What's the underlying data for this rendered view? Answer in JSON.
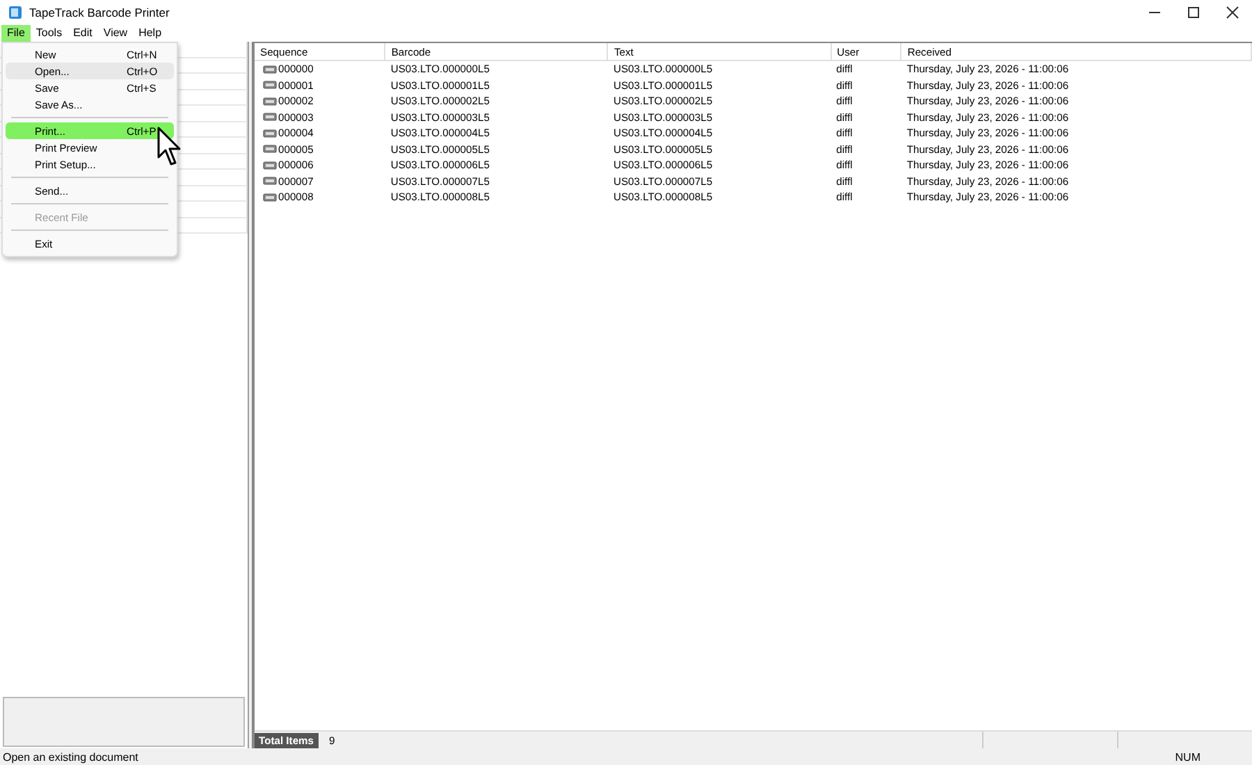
{
  "window": {
    "title": "TapeTrack Barcode Printer"
  },
  "menu_bar": [
    {
      "label": "File",
      "selected": true
    },
    {
      "label": "Tools",
      "selected": false
    },
    {
      "label": "Edit",
      "selected": false
    },
    {
      "label": "View",
      "selected": false
    },
    {
      "label": "Help",
      "selected": false
    }
  ],
  "file_menu": [
    {
      "kind": "item",
      "label": "New",
      "shortcut": "Ctrl+N",
      "selected": false,
      "hovered": false,
      "disabled": false
    },
    {
      "kind": "item",
      "label": "Open...",
      "shortcut": "Ctrl+O",
      "selected": false,
      "hovered": true,
      "disabled": false
    },
    {
      "kind": "item",
      "label": "Save",
      "shortcut": "Ctrl+S",
      "selected": false,
      "hovered": false,
      "disabled": false
    },
    {
      "kind": "item",
      "label": "Save As...",
      "selected": false,
      "hovered": false,
      "disabled": false
    },
    {
      "kind": "separator"
    },
    {
      "kind": "item",
      "label": "Print...",
      "shortcut": "Ctrl+P",
      "selected": true,
      "hovered": false,
      "disabled": false
    },
    {
      "kind": "item",
      "label": "Print Preview",
      "selected": false,
      "hovered": false,
      "disabled": false
    },
    {
      "kind": "item",
      "label": "Print Setup...",
      "selected": false,
      "hovered": false,
      "disabled": false
    },
    {
      "kind": "separator"
    },
    {
      "kind": "item",
      "label": "Send...",
      "selected": false,
      "hovered": false,
      "disabled": false
    },
    {
      "kind": "separator"
    },
    {
      "kind": "item",
      "label": "Recent File",
      "selected": false,
      "hovered": false,
      "disabled": true
    },
    {
      "kind": "separator"
    },
    {
      "kind": "item",
      "label": "Exit",
      "selected": false,
      "hovered": false,
      "disabled": false
    }
  ],
  "table": {
    "columns": [
      "Sequence",
      "Barcode",
      "Text",
      "User",
      "Received"
    ],
    "rows": [
      [
        "000000",
        "US03.LTO.000000L5",
        "US03.LTO.000000L5",
        "diffl",
        "Thursday, July 23, 2026 - 11:00:06"
      ],
      [
        "000001",
        "US03.LTO.000001L5",
        "US03.LTO.000001L5",
        "diffl",
        "Thursday, July 23, 2026 - 11:00:06"
      ],
      [
        "000002",
        "US03.LTO.000002L5",
        "US03.LTO.000002L5",
        "diffl",
        "Thursday, July 23, 2026 - 11:00:06"
      ],
      [
        "000003",
        "US03.LTO.000003L5",
        "US03.LTO.000003L5",
        "diffl",
        "Thursday, July 23, 2026 - 11:00:06"
      ],
      [
        "000004",
        "US03.LTO.000004L5",
        "US03.LTO.000004L5",
        "diffl",
        "Thursday, July 23, 2026 - 11:00:06"
      ],
      [
        "000005",
        "US03.LTO.000005L5",
        "US03.LTO.000005L5",
        "diffl",
        "Thursday, July 23, 2026 - 11:00:06"
      ],
      [
        "000006",
        "US03.LTO.000006L5",
        "US03.LTO.000006L5",
        "diffl",
        "Thursday, July 23, 2026 - 11:00:06"
      ],
      [
        "000007",
        "US03.LTO.000007L5",
        "US03.LTO.000007L5",
        "diffl",
        "Thursday, July 23, 2026 - 11:00:06"
      ],
      [
        "000008",
        "US03.LTO.000008L5",
        "US03.LTO.000008L5",
        "diffl",
        "Thursday, July 23, 2026 - 11:00:06"
      ]
    ]
  },
  "totals": {
    "label": "Total Items",
    "value": "9"
  },
  "status_bar": {
    "message": "Open an existing document",
    "indicator": "NUM"
  }
}
